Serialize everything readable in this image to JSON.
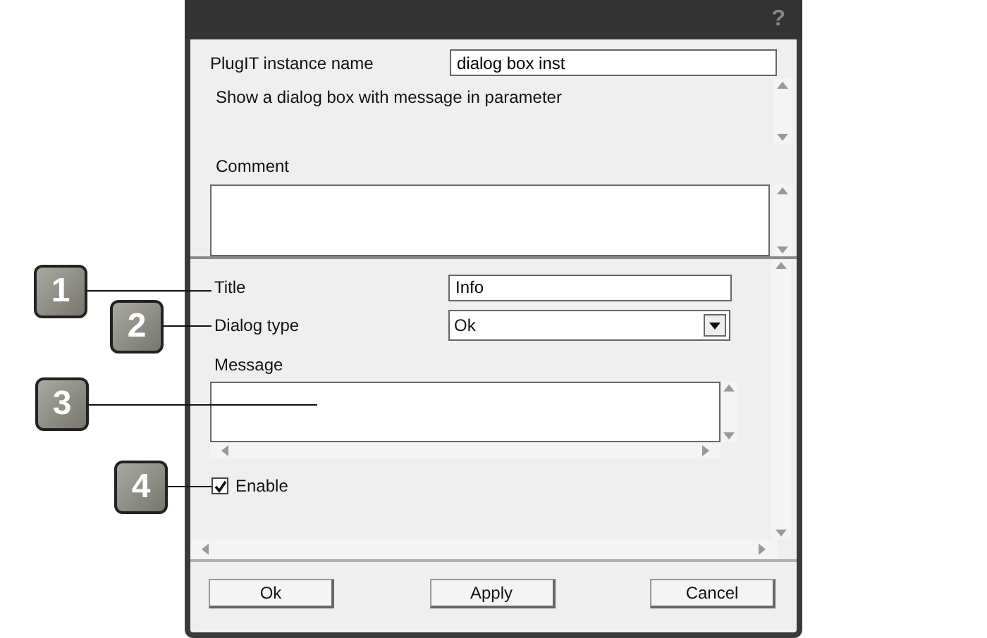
{
  "window": {
    "help": "?"
  },
  "instance": {
    "label": "PlugIT instance name",
    "value": "dialog box inst"
  },
  "description": "Show a dialog box with message in parameter",
  "comment": {
    "label": "Comment"
  },
  "parameters": [
    {
      "kind": "text",
      "label": "Title",
      "value": "Info"
    },
    {
      "kind": "select",
      "label": "Dialog type",
      "value": "Ok"
    },
    {
      "kind": "textarea",
      "label": "Message"
    },
    {
      "kind": "checkbox",
      "label": "Enable",
      "checked": true
    }
  ],
  "callouts": [
    {
      "number": "1"
    },
    {
      "number": "2"
    },
    {
      "number": "3"
    },
    {
      "number": "4"
    }
  ],
  "buttons": [
    "Ok",
    "Apply",
    "Cancel"
  ]
}
